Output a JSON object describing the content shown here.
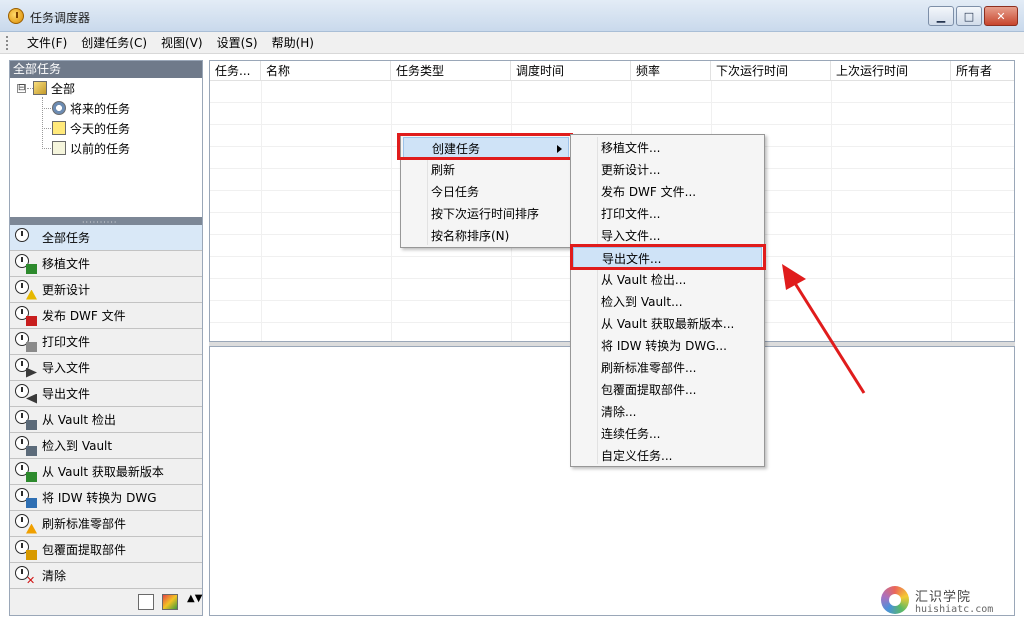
{
  "window": {
    "title": "任务调度器",
    "minimize": "▁",
    "maximize": "□",
    "close": "✕"
  },
  "menubar": [
    "文件(F)",
    "创建任务(C)",
    "视图(V)",
    "设置(S)",
    "帮助(H)"
  ],
  "tree": {
    "header": "全部任务",
    "expander": "⊟",
    "root": "全部",
    "children": [
      "将来的任务",
      "今天的任务",
      "以前的任务"
    ]
  },
  "nav": [
    {
      "label": "全部任务",
      "icon": "all-tasks-icon",
      "active": true
    },
    {
      "label": "移植文件",
      "icon": "migrate-files-icon"
    },
    {
      "label": "更新设计",
      "icon": "update-design-icon"
    },
    {
      "label": "发布 DWF 文件",
      "icon": "publish-dwf-icon"
    },
    {
      "label": "打印文件",
      "icon": "print-files-icon"
    },
    {
      "label": "导入文件",
      "icon": "import-files-icon"
    },
    {
      "label": "导出文件",
      "icon": "export-files-icon"
    },
    {
      "label": "从 Vault 检出",
      "icon": "vault-checkout-icon"
    },
    {
      "label": "检入到 Vault",
      "icon": "vault-checkin-icon"
    },
    {
      "label": "从 Vault 获取最新版本",
      "icon": "vault-get-latest-icon"
    },
    {
      "label": "将 IDW 转换为 DWG",
      "icon": "idw-to-dwg-icon"
    },
    {
      "label": "刷新标准零部件",
      "icon": "refresh-standard-parts-icon"
    },
    {
      "label": "包覆面提取部件",
      "icon": "shrinkwrap-parts-icon"
    },
    {
      "label": "清除",
      "icon": "clear-icon"
    }
  ],
  "left_bottom": {
    "arrow": "▲▼"
  },
  "grid": {
    "columns": [
      "任务...",
      "名称",
      "任务类型",
      "调度时间",
      "频率",
      "下次运行时间",
      "上次运行时间",
      "所有者"
    ]
  },
  "context_menu": {
    "items": [
      "创建任务",
      "刷新",
      "今日任务",
      "按下次运行时间排序",
      "按名称排序(N)"
    ],
    "highlighted": "创建任务"
  },
  "submenu": {
    "items": [
      "移植文件...",
      "更新设计...",
      "发布 DWF 文件...",
      "打印文件...",
      "导入文件...",
      "导出文件...",
      "从 Vault 检出...",
      "检入到 Vault...",
      "从 Vault 获取最新版本...",
      "将 IDW 转换为 DWG...",
      "刷新标准零部件...",
      "包覆面提取部件...",
      "清除...",
      "连续任务...",
      "自定义任务..."
    ],
    "highlighted": "导出文件..."
  },
  "annotation": {
    "color": "#e01c1c"
  },
  "watermark": {
    "cn": "汇识学院",
    "en": "huishiatc.com"
  }
}
